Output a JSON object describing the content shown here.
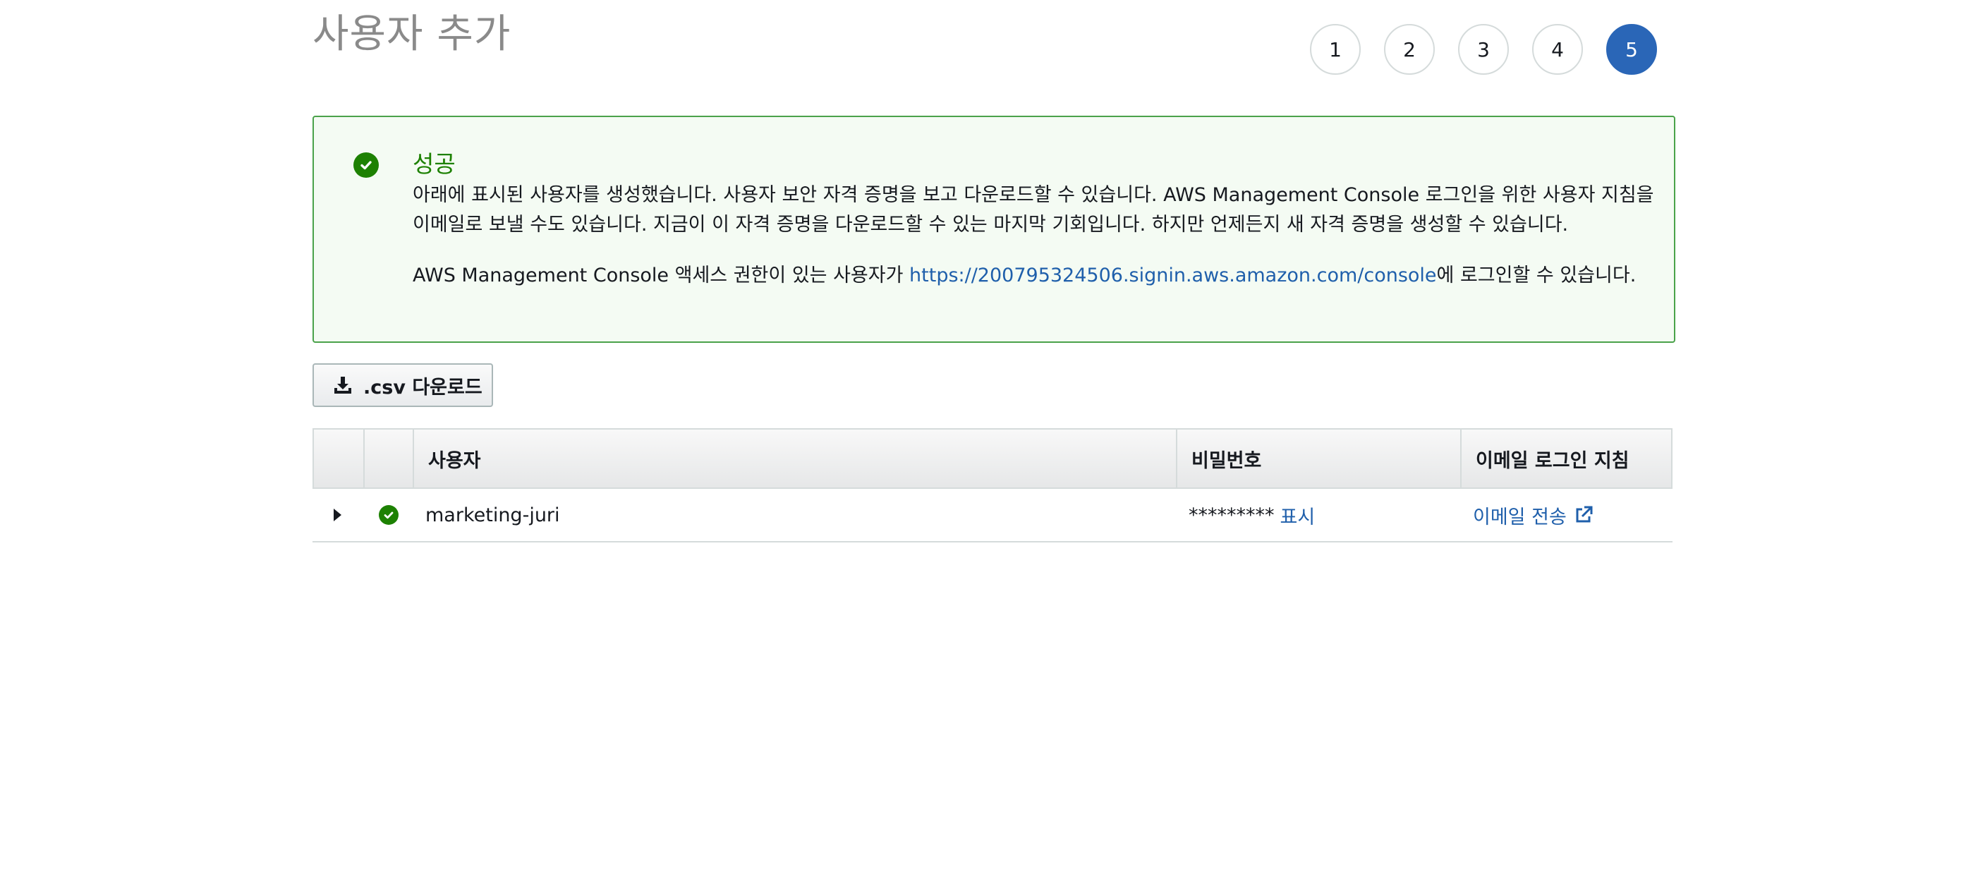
{
  "page": {
    "title": "사용자 추가"
  },
  "steps": [
    {
      "label": "1",
      "active": false
    },
    {
      "label": "2",
      "active": false
    },
    {
      "label": "3",
      "active": false
    },
    {
      "label": "4",
      "active": false
    },
    {
      "label": "5",
      "active": true
    }
  ],
  "alert": {
    "icon": "check-circle-icon",
    "title": "성공",
    "message1": "아래에 표시된 사용자를 생성했습니다. 사용자 보안 자격 증명을 보고 다운로드할 수 있습니다. AWS Management Console 로그인을 위한 사용자 지침을 이메일로 보낼 수도 있습니다. 지금이 이 자격 증명을 다운로드할 수 있는 마지막 기회입니다. 하지만 언제든지 새 자격 증명을 생성할 수 있습니다.",
    "message2_prefix": "AWS Management Console 액세스 권한이 있는 사용자가 ",
    "message2_link": "https://200795324506.signin.aws.amazon.com/console",
    "message2_suffix": "에 로그인할 수 있습니다.",
    "color": "#1d8102"
  },
  "actions": {
    "download_csv_label": ".csv 다운로드",
    "download_icon": "download-icon"
  },
  "table": {
    "headers": {
      "user": "사용자",
      "password": "비밀번호",
      "email_instructions": "이메일 로그인 지침"
    },
    "rows": [
      {
        "user": "marketing-juri",
        "password_mask": "*********",
        "show_label": "표시",
        "send_email_label": "이메일 전송",
        "status_icon": "check-circle-icon",
        "expand_icon": "caret-right-icon",
        "external_icon": "external-link-icon"
      }
    ]
  },
  "colors": {
    "accent": "#2a66b7",
    "link": "#1f5fab",
    "success": "#1d8102"
  }
}
